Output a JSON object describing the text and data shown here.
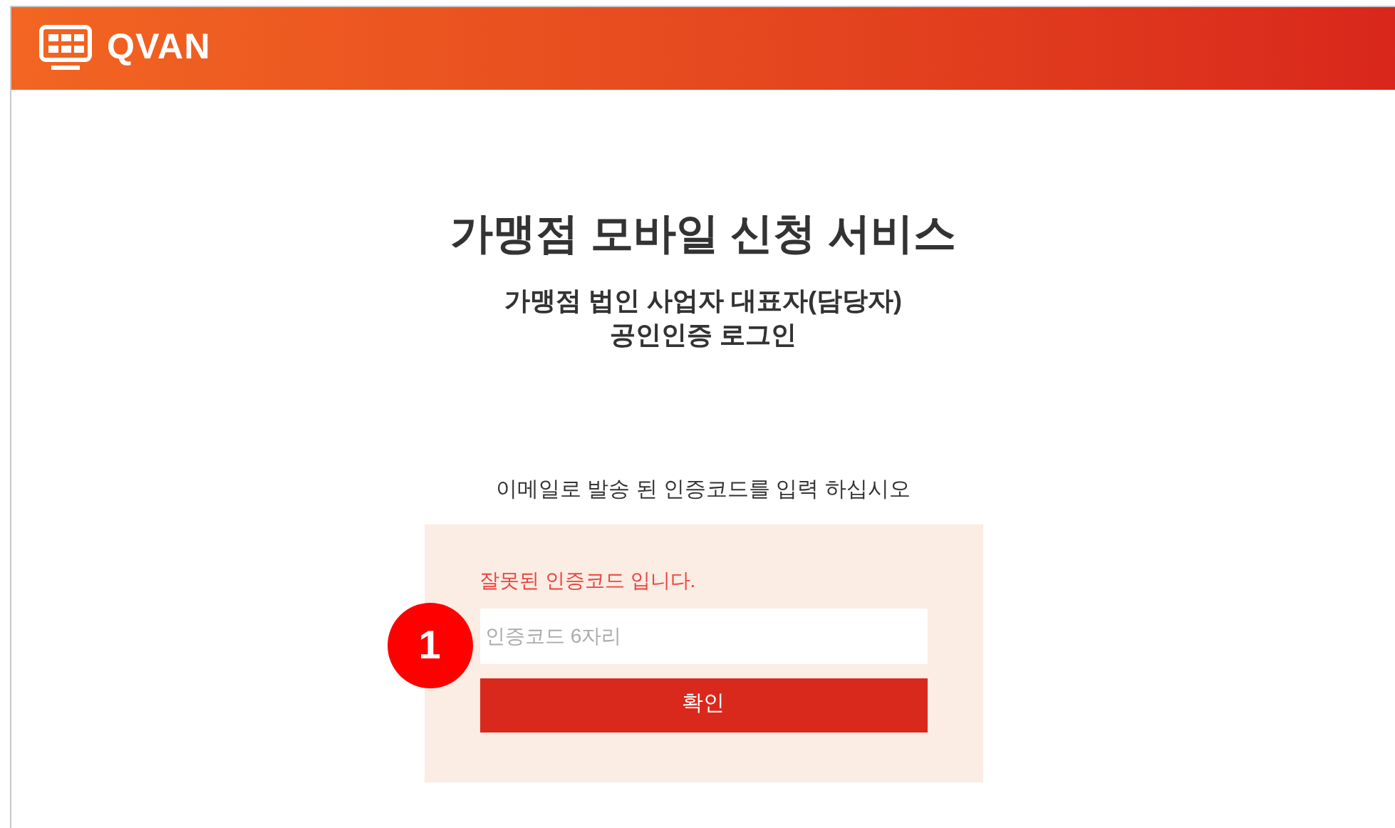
{
  "header": {
    "logo_text": "QVAN"
  },
  "title": "가맹점 모바일 신청 서비스",
  "subtitle_lines": [
    "가맹점 법인 사업자 대표자(담당자)",
    "공인인증 로그인"
  ],
  "instruction": "이메일로 발송 된 인증코드를 입력 하십시오",
  "form": {
    "error": "잘못된 인증코드 입니다.",
    "code_field": {
      "placeholder": "인증코드 6자리"
    },
    "submit_button": "확인"
  },
  "callout": "1"
}
